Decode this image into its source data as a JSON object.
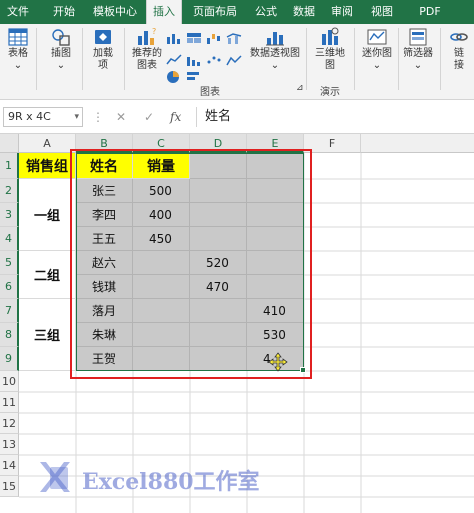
{
  "menu": {
    "tabs": [
      "文件",
      "开始",
      "模板中心",
      "插入",
      "页面布局",
      "公式",
      "数据",
      "审阅",
      "视图",
      "PDF"
    ],
    "active": "插入"
  },
  "ribbon": {
    "buttons": {
      "table": "表格",
      "illustration": "插图",
      "addins": "加载",
      "addins2": "项",
      "recommended_charts": "推荐的",
      "recommended_charts2": "图表",
      "pivot_chart": "数据透视图",
      "map3d": "三维地",
      "map3d2": "图",
      "sparkline": "迷你图",
      "filter": "筛选器",
      "link": "链",
      "link2": "接"
    },
    "groups": {
      "charts": "图表",
      "tours": "演示",
      "dialog_launcher": "⊿"
    }
  },
  "formula_bar": {
    "name_box": "9R x 4C",
    "fx": "fx",
    "cancel": "✕",
    "enter": "✓",
    "content": "姓名"
  },
  "sheet": {
    "columns": [
      "A",
      "B",
      "C",
      "D",
      "E",
      "F"
    ],
    "rows": [
      "1",
      "2",
      "3",
      "4",
      "5",
      "6",
      "7",
      "8",
      "9",
      "10",
      "11",
      "12",
      "13",
      "14",
      "15"
    ],
    "headers": {
      "group": "销售组",
      "name": "姓名",
      "sales": "销量"
    },
    "groups": [
      "一组",
      "二组",
      "三组"
    ],
    "names": [
      "张三",
      "李四",
      "王五",
      "赵六",
      "钱琪",
      "落月",
      "朱琳",
      "王贺"
    ],
    "values_c": [
      "500",
      "400",
      "450"
    ],
    "values_d": [
      "520",
      "470"
    ],
    "values_e": [
      "410",
      "530",
      "4"
    ]
  },
  "watermark": {
    "text": "Excel880工作室"
  },
  "colors": {
    "excel_green": "#217346",
    "header_yellow": "#ffff00",
    "selection_gray": "#c9c9c9",
    "highlight_red": "#e02020"
  }
}
